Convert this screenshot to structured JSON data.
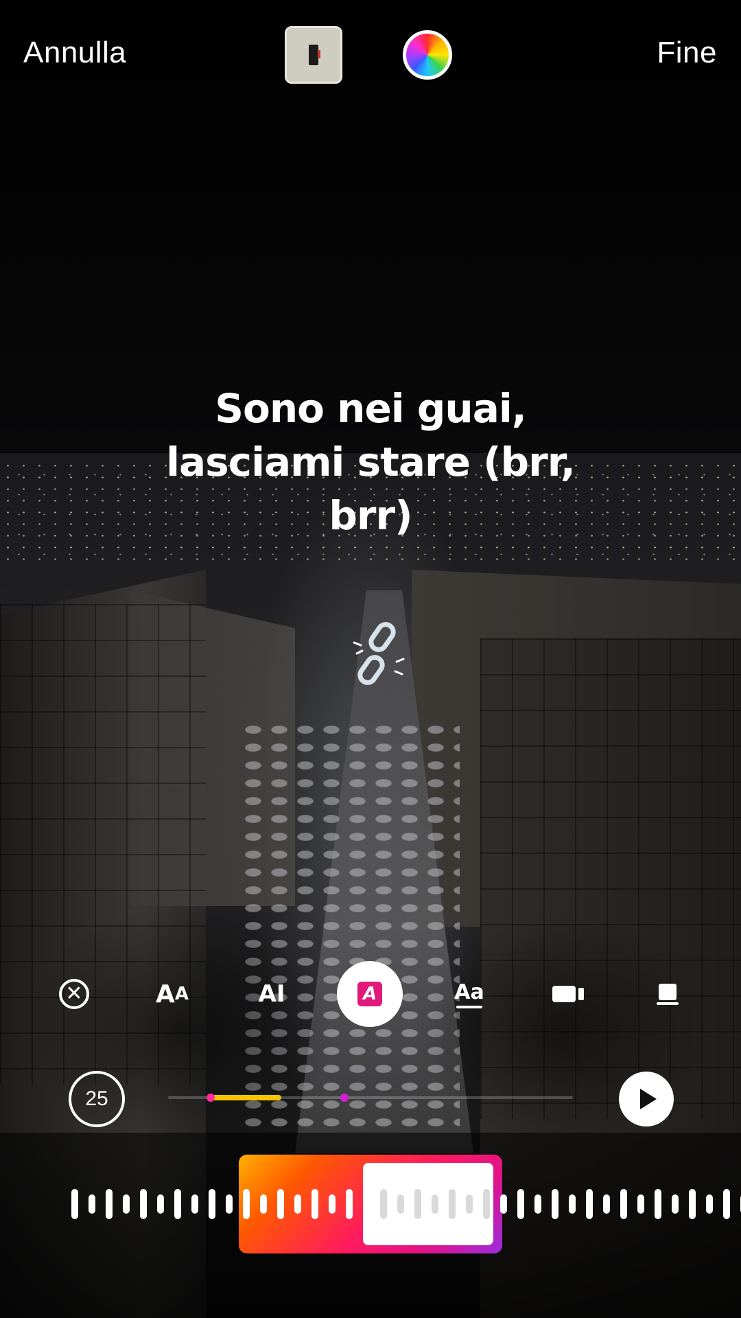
{
  "header": {
    "cancel_label": "Annulla",
    "done_label": "Fine",
    "background_thumbnail_icon": "phone-thumbnail-icon",
    "color_picker_icon": "color-wheel-icon"
  },
  "lyrics": {
    "line1": "Sono nei guai,",
    "line2": "lasciami stare (brr,",
    "line3": "brr)"
  },
  "sticker": {
    "icon": "chain-link-icon"
  },
  "toolbar": {
    "items": [
      {
        "icon": "close-circle-icon",
        "label": "✕"
      },
      {
        "icon": "text-size-style-icon",
        "label": "AA"
      },
      {
        "icon": "typewriter-text-icon",
        "label": "AI"
      },
      {
        "icon": "highlight-text-icon",
        "label": "A",
        "active": true
      },
      {
        "icon": "underline-text-icon",
        "label": "Aa"
      },
      {
        "icon": "camera-icon",
        "label": ""
      },
      {
        "icon": "card-icon",
        "label": ""
      }
    ]
  },
  "playback": {
    "duration": "25",
    "play_icon": "play-icon"
  },
  "colors": {
    "highlight_pink": "#e0197a",
    "scrub_yellow": "#f5c400",
    "selector_gradient": [
      "#ffb000",
      "#ff5a00",
      "#ff1a5e",
      "#e0138a",
      "#9b2de0"
    ]
  }
}
